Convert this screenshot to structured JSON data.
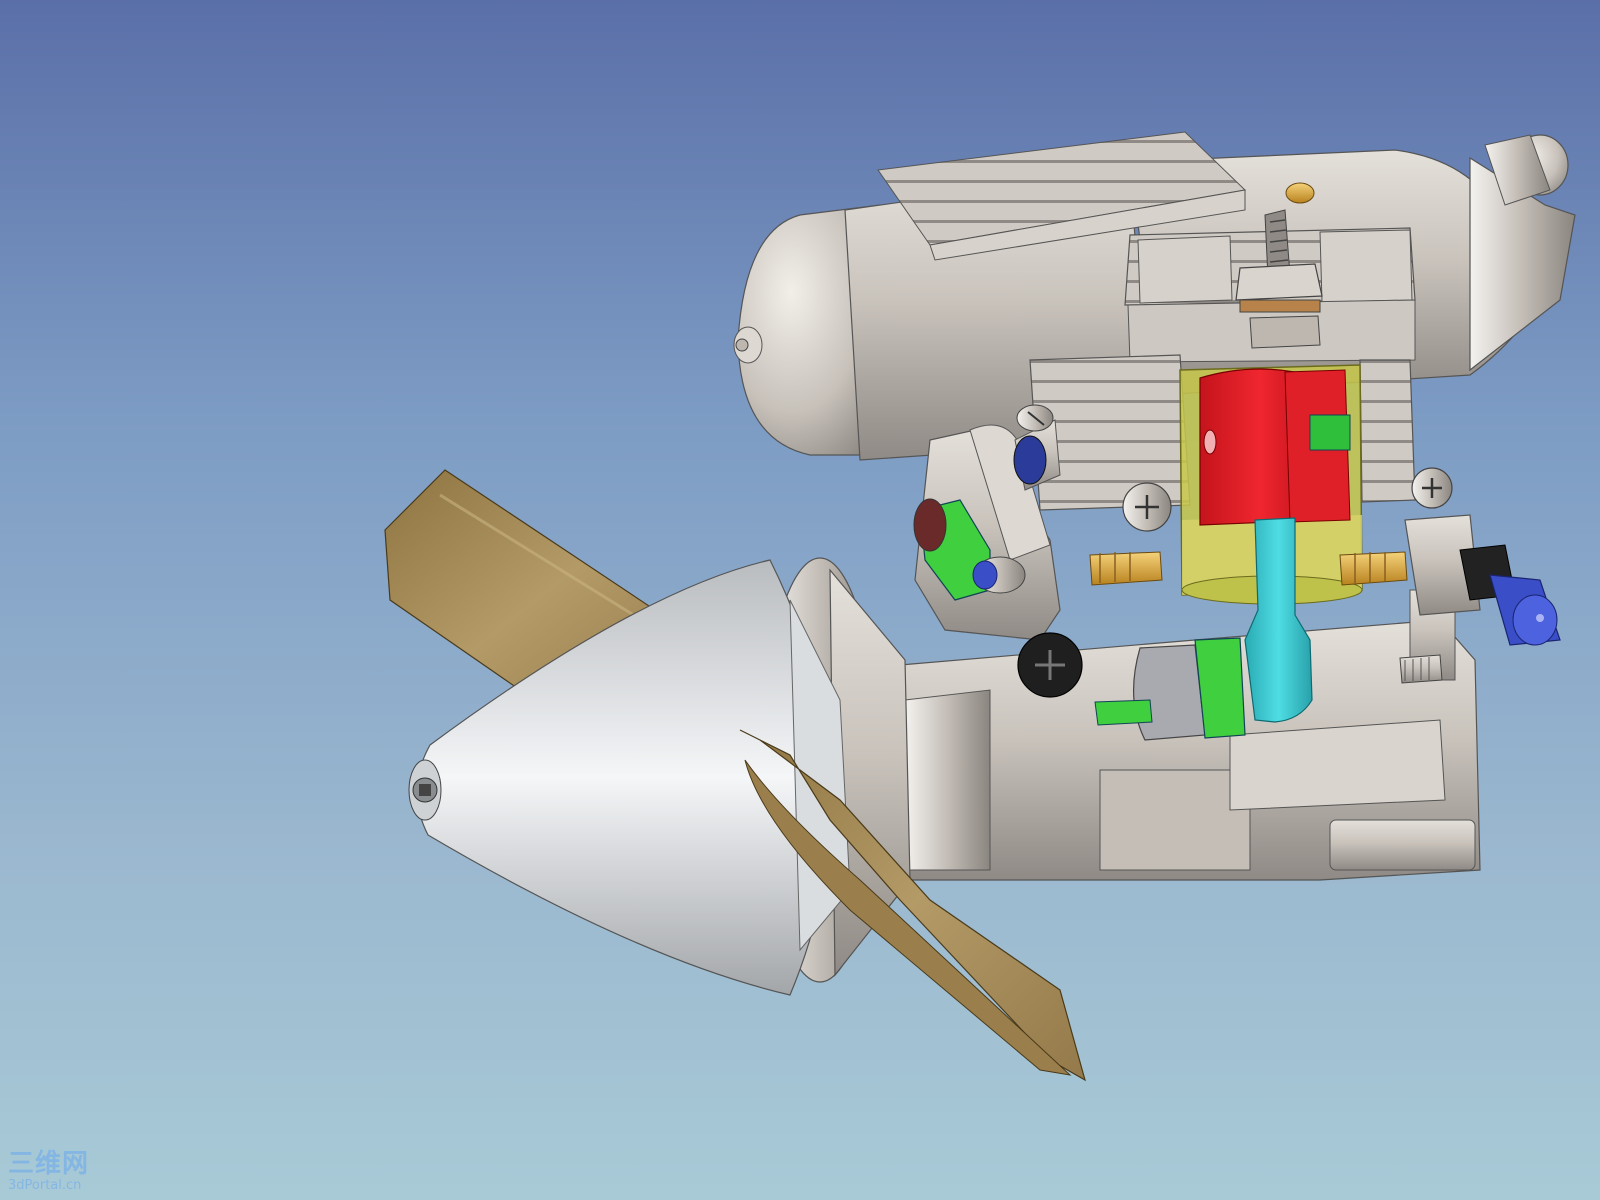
{
  "viewport": {
    "background_top": "#5a6fa8",
    "background_bottom": "#a8cad6"
  },
  "model": {
    "parts": [
      "fuel-tank",
      "cylinder-head",
      "cooling-fins",
      "piston",
      "connecting-rod",
      "crankcase",
      "crankshaft",
      "spinner",
      "propeller",
      "needle-valve",
      "carburetor",
      "glow-plug",
      "fuel-nipple",
      "screws"
    ],
    "colors": {
      "metal": "#c9c3bc",
      "piston": "#e8202a",
      "connecting_rod": "#34c7d0",
      "green_parts": "#3fcf3f",
      "cylinder_sleeve": "#c8c84a",
      "blue_parts": "#3a4ec8",
      "brass": "#d9a93a",
      "wood": "#a78c5a"
    }
  },
  "watermark": {
    "cn": "三维网",
    "en": "3dPortal.cn"
  }
}
